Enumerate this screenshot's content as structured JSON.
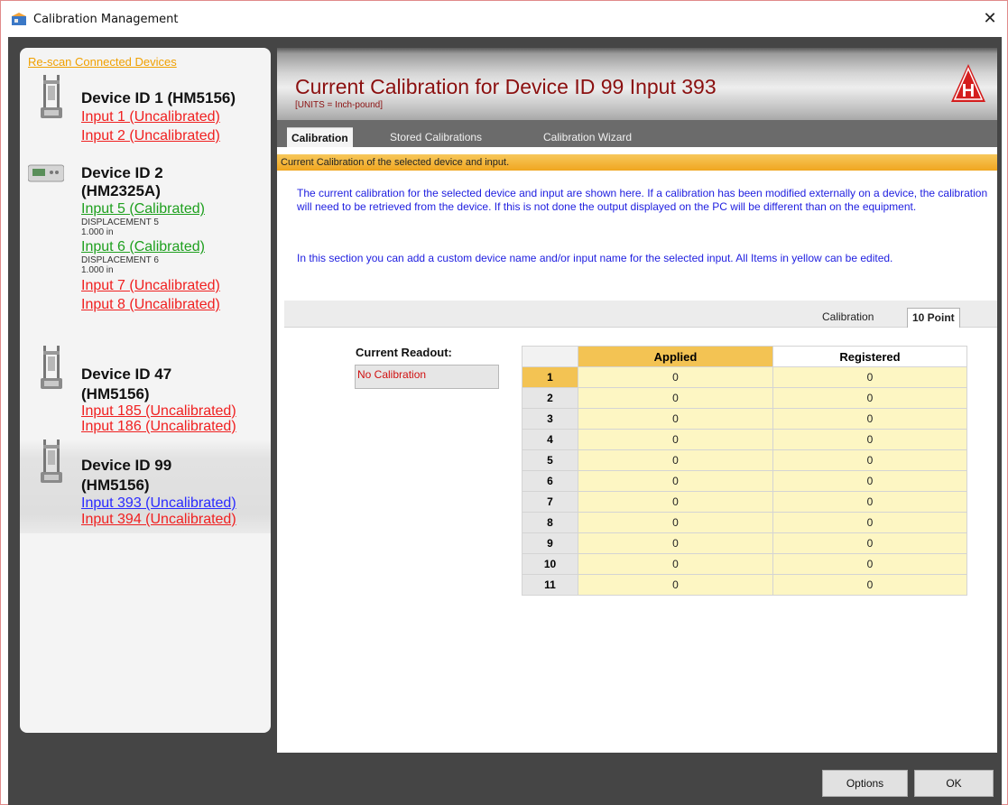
{
  "window": {
    "title": "Calibration Management",
    "close_glyph": "✕"
  },
  "sidebar": {
    "rescan_label": "Re-scan Connected Devices",
    "devices": [
      {
        "title_line1": "Device ID 1 (HM5156)",
        "title_line2": "",
        "icon": "load-frame-icon",
        "inputs": [
          {
            "label": "Input 1 (Uncalibrated)",
            "status": "uncalibrated"
          },
          {
            "label": "Input 2 (Uncalibrated)",
            "status": "uncalibrated"
          }
        ]
      },
      {
        "title_line1": "Device ID 2",
        "title_line2": "(HM2325A)",
        "icon": "data-logger-icon",
        "inputs": [
          {
            "label": "Input 5 (Calibrated)",
            "status": "calibrated",
            "sub_name": "DISPLACEMENT 5",
            "sub_value": "1.000 in"
          },
          {
            "label": "Input 6 (Calibrated)",
            "status": "calibrated",
            "sub_name": "DISPLACEMENT 6",
            "sub_value": "1.000 in"
          },
          {
            "label": "Input 7 (Uncalibrated)",
            "status": "uncalibrated"
          },
          {
            "label": "Input 8 (Uncalibrated)",
            "status": "uncalibrated"
          }
        ]
      },
      {
        "title_line1": "Device ID 47",
        "title_line2": "(HM5156)",
        "icon": "load-frame-icon",
        "inputs": [
          {
            "label": "Input 185 (Uncalibrated)",
            "status": "uncalibrated"
          },
          {
            "label": "Input 186 (Uncalibrated)",
            "status": "uncalibrated"
          }
        ]
      },
      {
        "title_line1": "Device ID 99",
        "title_line2": "(HM5156)",
        "icon": "load-frame-icon",
        "selected": true,
        "inputs": [
          {
            "label": "Input 393 (Uncalibrated)",
            "status": "selected"
          },
          {
            "label": "Input 394 (Uncalibrated)",
            "status": "uncalibrated"
          }
        ]
      }
    ]
  },
  "header": {
    "title": "Current Calibration for Device ID 99 Input 393",
    "units": "[UNITS = Inch-pound]",
    "logo_letter": "H"
  },
  "tabs": [
    {
      "label": "Calibration",
      "active": true
    },
    {
      "label": "Stored Calibrations",
      "active": false
    },
    {
      "label": "Calibration Wizard",
      "active": false
    }
  ],
  "section_banner": "Current Calibration of the selected device and  input.",
  "description": {
    "para1": "The current calibration for the selected device and input are shown here.  If a calibration has been modified externally on a device, the calibration will need to be retrieved from the device.  If this is not done the output displayed on the PC will be different than on the equipment.",
    "para2": "In this section you can add a custom device name and/or input name for the selected input.  All Items in yellow can be edited."
  },
  "subtabs": [
    {
      "label": "Calibration",
      "active": false
    },
    {
      "label": "10 Point",
      "active": true
    }
  ],
  "readout": {
    "label": "Current Readout:",
    "value": "No Calibration"
  },
  "grid": {
    "columns": [
      "Applied",
      "Registered"
    ],
    "rows": [
      {
        "n": "1",
        "applied": "0",
        "registered": "0"
      },
      {
        "n": "2",
        "applied": "0",
        "registered": "0"
      },
      {
        "n": "3",
        "applied": "0",
        "registered": "0"
      },
      {
        "n": "4",
        "applied": "0",
        "registered": "0"
      },
      {
        "n": "5",
        "applied": "0",
        "registered": "0"
      },
      {
        "n": "6",
        "applied": "0",
        "registered": "0"
      },
      {
        "n": "7",
        "applied": "0",
        "registered": "0"
      },
      {
        "n": "8",
        "applied": "0",
        "registered": "0"
      },
      {
        "n": "9",
        "applied": "0",
        "registered": "0"
      },
      {
        "n": "10",
        "applied": "0",
        "registered": "0"
      },
      {
        "n": "11",
        "applied": "0",
        "registered": "0"
      }
    ]
  },
  "footer": {
    "options_label": "Options",
    "ok_label": "OK"
  },
  "colors": {
    "header_title": "#8b1010",
    "banner": "#f0a620",
    "applied_header": "#f3c353",
    "editable_cell": "#fdf6c3",
    "uncalibrated": "#f02020",
    "calibrated": "#1fa01f",
    "selected_input": "#2a2aff"
  }
}
